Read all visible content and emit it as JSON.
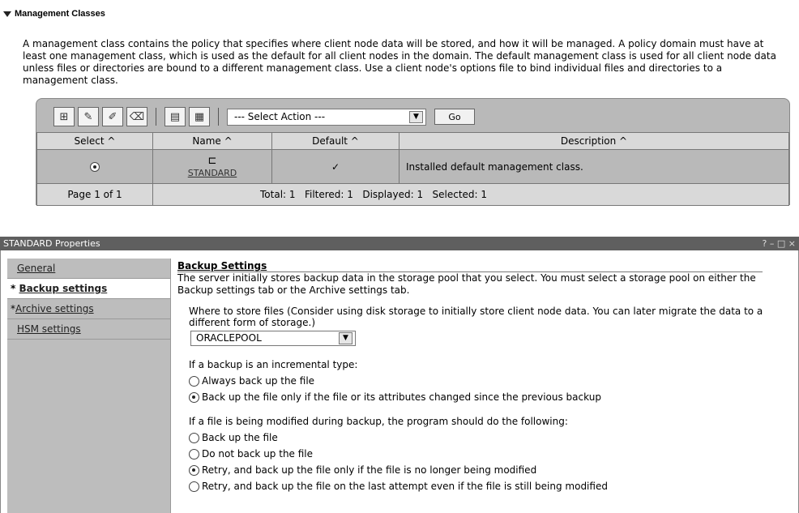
{
  "management_classes": {
    "title": "Management Classes",
    "description": "A management class contains the policy that specifies where client node data will be stored, and how it will be managed. A policy domain must have at least one management class, which is used as the default for all client nodes in the domain. The default management class is used for all client node data unless files or directories are bound to a different management class. Use a client node's options file to bind individual files and directories to a management class.",
    "select_action_label": "--- Select Action ---",
    "go_label": "Go",
    "columns": [
      "Select ^",
      "Name ^",
      "Default ^",
      "Description ^"
    ],
    "rows": [
      {
        "name": "STANDARD",
        "default": "✓",
        "description": "Installed default management class."
      }
    ],
    "footer_page": "Page 1 of 1",
    "footer_summary": "Total: 1   Filtered: 1   Displayed: 1   Selected: 1"
  },
  "properties": {
    "window_title": "STANDARD Properties",
    "window_controls": "? – □ ×",
    "tabs": [
      {
        "label": "General",
        "starred": false,
        "active": false
      },
      {
        "label": "Backup settings",
        "starred": true,
        "active": true
      },
      {
        "label": "Archive settings",
        "starred": true,
        "active": false
      },
      {
        "label": "HSM settings",
        "starred": false,
        "active": false
      }
    ],
    "section_title": "Backup Settings",
    "section_desc": "The server initially stores backup data in the storage pool that you select. You must select a storage pool on either the Backup settings tab or the Archive settings tab.",
    "where_label": "Where to store files (Consider using disk storage to initially store client node data. You can later migrate the data to a different form of storage.)",
    "pool_value": "ORACLEPOOL",
    "incremental_question": "If a backup is an incremental type:",
    "incremental_options": [
      {
        "label": "Always back up the file",
        "checked": false
      },
      {
        "label": "Back up the file only if the file or its attributes changed since the previous backup",
        "checked": true
      }
    ],
    "modified_question": "If a file is being modified during backup, the program should do the following:",
    "modified_options": [
      {
        "label": "Back up the file",
        "checked": false
      },
      {
        "label": "Do not back up the file",
        "checked": false
      },
      {
        "label": "Retry, and back up the file only if the file is no longer being modified",
        "checked": true
      },
      {
        "label": "Retry, and back up the file on the last attempt even if the file is still being modified",
        "checked": false
      }
    ]
  }
}
